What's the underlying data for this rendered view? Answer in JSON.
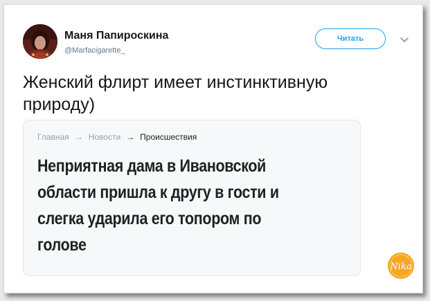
{
  "author": {
    "name": "Маня Папироскина",
    "handle": "@Marfacigarette_"
  },
  "actions": {
    "follow_label": "Читать"
  },
  "tweet": {
    "lines": [
      "Женский флирт имеет инстинктивную",
      "природу)"
    ]
  },
  "card": {
    "breadcrumbs": [
      "Главная",
      "Новости",
      "Происшествия"
    ],
    "headline_lines": [
      "Неприятная дама в Ивановской",
      "области пришла к другу в гости и",
      "слегка ударила его топором по",
      "голове"
    ]
  },
  "watermark": {
    "text": "Nika"
  },
  "colors": {
    "accent": "#1da1f2",
    "text": "#14171a",
    "muted": "#657786",
    "watermark": "#f5a623"
  },
  "icons": {
    "chevron": "chevron-down-icon",
    "crumb_separator": "arrow-right-icon"
  }
}
